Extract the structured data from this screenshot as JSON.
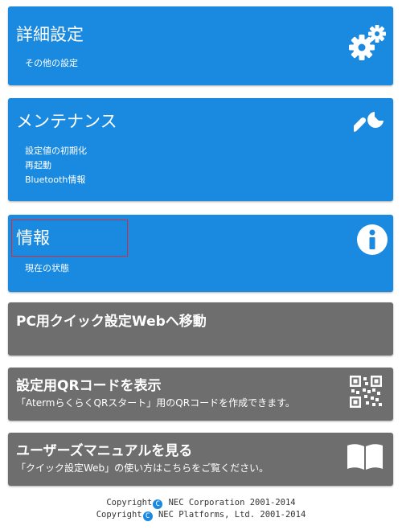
{
  "cards": {
    "advanced": {
      "title": "詳細設定",
      "items": [
        "その他の設定"
      ],
      "icon": "gears-icon"
    },
    "maintenance": {
      "title": "メンテナンス",
      "items": [
        "設定値の初期化",
        "再起動",
        "Bluetooth情報"
      ],
      "icon": "wrench-icon"
    },
    "info": {
      "title": "情報",
      "items": [
        "現在の状態"
      ],
      "icon": "info-icon"
    }
  },
  "actions": {
    "pc_web": {
      "title": "PC用クイック設定Webへ移動"
    },
    "qr": {
      "title": "設定用QRコードを表示",
      "subtitle": "「AtermらくらくQRスタート」用のQRコードを作成できます。",
      "icon": "qr-code-icon"
    },
    "manual": {
      "title": "ユーザーズマニュアルを見る",
      "subtitle": "「クイック設定Web」の使い方はこちらをご覧ください。",
      "icon": "book-icon"
    }
  },
  "footer": {
    "line1_prefix": "Copyright",
    "line1_mark": "C",
    "line1_suffix": " NEC Corporation 2001-2014",
    "line2_prefix": "Copyright",
    "line2_mark": "C",
    "line2_suffix": " NEC Platforms, Ltd. 2001-2014"
  },
  "colors": {
    "card_blue": "#1a8ae0",
    "card_gray": "#6e6e6e",
    "highlight_red": "#d8283c"
  }
}
